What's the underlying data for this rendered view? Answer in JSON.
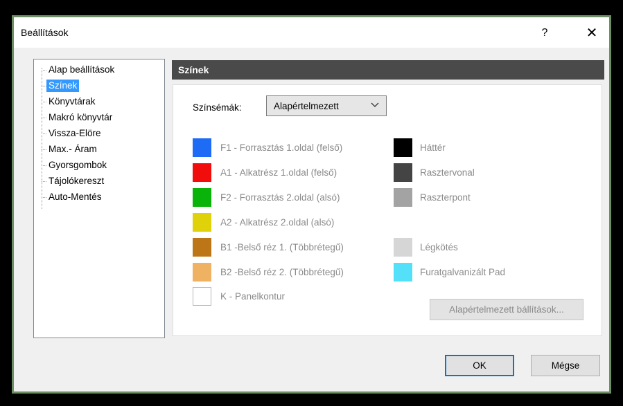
{
  "window": {
    "title": "Beállítások",
    "help_label": "?",
    "close_label": "✕"
  },
  "tree": {
    "items": [
      {
        "label": "Alap beállítások",
        "selected": false
      },
      {
        "label": "Színek",
        "selected": true
      },
      {
        "label": "Könyvtárak",
        "selected": false
      },
      {
        "label": "Makró könyvtár",
        "selected": false
      },
      {
        "label": "Vissza-Elöre",
        "selected": false
      },
      {
        "label": "Max.- Áram",
        "selected": false
      },
      {
        "label": "Gyorsgombok",
        "selected": false
      },
      {
        "label": "Tájolókereszt",
        "selected": false
      },
      {
        "label": "Auto-Mentés",
        "selected": false
      }
    ]
  },
  "panel": {
    "header": "Színek",
    "scheme_label": "Színsémák:",
    "scheme_value": "Alapértelmezett",
    "left_colors": [
      {
        "label": "F1 - Forrasztás 1.oldal (felső)",
        "color": "#1e6cf5"
      },
      {
        "label": "A1 - Alkatrész 1.oldal (felső)",
        "color": "#f20d0d"
      },
      {
        "label": "F2 - Forrasztás 2.oldal (alsó)",
        "color": "#0ab30a"
      },
      {
        "label": "A2 - Alkatrész 2.oldal (alsó)",
        "color": "#e0d20a"
      },
      {
        "label": "B1 -Belső réz 1. (Többrétegű)",
        "color": "#bc7618"
      },
      {
        "label": "B2 -Belső réz 2. (Többrétegű)",
        "color": "#efb263"
      },
      {
        "label": "K - Panelkontur",
        "color": "#ffffff"
      }
    ],
    "right_colors": [
      {
        "label": "Háttér",
        "color": "#000000"
      },
      {
        "label": "Rasztervonal",
        "color": "#444444"
      },
      {
        "label": "Raszterpont",
        "color": "#a3a3a3"
      },
      {
        "label": "Légkötés",
        "color": "#d6d6d6"
      },
      {
        "label": "Furatgalvanizált Pad",
        "color": "#55e0fa"
      }
    ],
    "defaults_button": "Alapértelmezett bállítások..."
  },
  "footer": {
    "ok": "OK",
    "cancel": "Mégse"
  }
}
